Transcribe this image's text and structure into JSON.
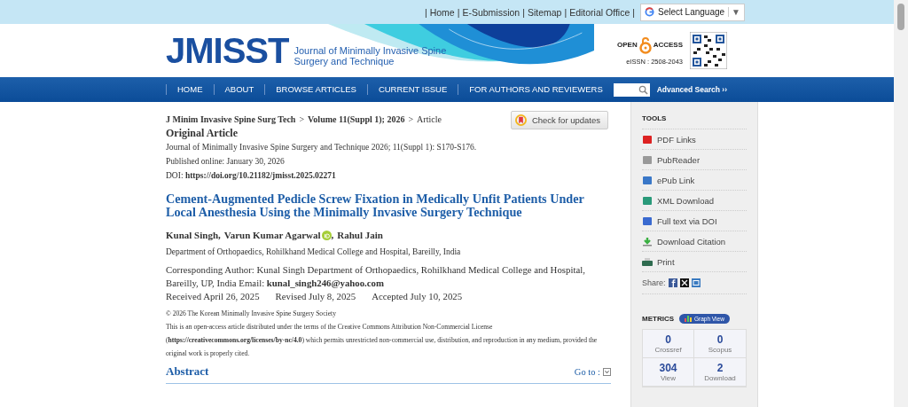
{
  "top_bar": {
    "links": [
      "Home",
      "E-Submission",
      "Sitemap",
      "Editorial Office"
    ],
    "separator": "|",
    "language": {
      "label": "Select Language",
      "caret": "▼"
    }
  },
  "header": {
    "logo": "JMISST",
    "journal_name": [
      "Journal of Minimally Invasive Spine",
      "Surgery and Technique"
    ],
    "open_access": [
      "OPEN",
      "ACCESS"
    ],
    "eissn": "eISSN : 2508-2043"
  },
  "nav": {
    "items": [
      "HOME",
      "ABOUT",
      "BROWSE ARTICLES",
      "CURRENT ISSUE",
      "FOR AUTHORS AND REVIEWERS"
    ],
    "advanced_search": "Advanced Search ››"
  },
  "article": {
    "breadcrumb": {
      "items": [
        "J Minim Invasive Spine Surg Tech",
        "Volume 11(Suppl 1); 2026",
        "Article"
      ],
      "separator": ">"
    },
    "check_updates": "Check for updates",
    "type": "Original Article",
    "citation": "Journal of Minimally Invasive Spine Surgery and Technique 2026; 11(Suppl 1): S170-S176.",
    "published": "Published online: January 30, 2026",
    "doi": {
      "label": "DOI:",
      "link": "https://doi.org/10.21182/jmisst.2025.02271"
    },
    "title": "Cement-Augmented Pedicle Screw Fixation in Medically Unfit Patients Under Local Anesthesia Using the Minimally Invasive Surgery Technique",
    "author_separator": ",",
    "authors": [
      {
        "name": "Kunal Singh",
        "orcid": false
      },
      {
        "name": "Varun Kumar Agarwal",
        "orcid": true
      },
      {
        "name": "Rahul Jain",
        "orcid": false
      }
    ],
    "affiliation": "Department of Orthopaedics, Rohilkhand Medical College and Hospital, Bareilly, India",
    "corresponding": "Corresponding Author: Kunal Singh Department of Orthopaedics, Rohilkhand Medical College and Hospital, Bareilly, UP, India Email: **kunal_singh246@yahoo.com**",
    "dates": [
      "Received April 26, 2025",
      "Revised July 8, 2025",
      "Accepted July 10, 2025"
    ],
    "copyright": "© 2026 The Korean Minimally Invasive Spine Surgery Society",
    "license": "This is an open-access article distributed under the terms of the Creative Commons Attribution Non-Commercial License (**https://creativecommons.org/licenses/by-nc/4.0**) which permits unrestricted non-commercial use, distribution, and reproduction in any medium, provided the original work is properly cited.",
    "section": {
      "heading": "Abstract",
      "goto": "Go to :"
    }
  },
  "sidebar": {
    "tools": {
      "heading": "TOOLS",
      "items": [
        {
          "kind": "pdf",
          "label": "PDF Links"
        },
        {
          "kind": "reader",
          "label": "PubReader"
        },
        {
          "kind": "epub",
          "label": "ePub Link"
        },
        {
          "kind": "xml",
          "label": "XML Download"
        },
        {
          "kind": "doi",
          "label": "Full text via DOI"
        },
        {
          "kind": "download",
          "label": "Download Citation"
        },
        {
          "kind": "print",
          "label": "Print"
        }
      ],
      "share": {
        "label": "Share:",
        "networks": [
          {
            "kind": "facebook"
          },
          {
            "kind": "x"
          },
          {
            "kind": "linkedin"
          }
        ]
      }
    },
    "metrics": {
      "heading": "METRICS",
      "graph_view": "Graph View",
      "cells": [
        {
          "value": "0",
          "label": "Crossref"
        },
        {
          "value": "0",
          "label": "Scopus"
        },
        {
          "value": "304",
          "label": "View"
        },
        {
          "value": "2",
          "label": "Download"
        }
      ]
    }
  }
}
